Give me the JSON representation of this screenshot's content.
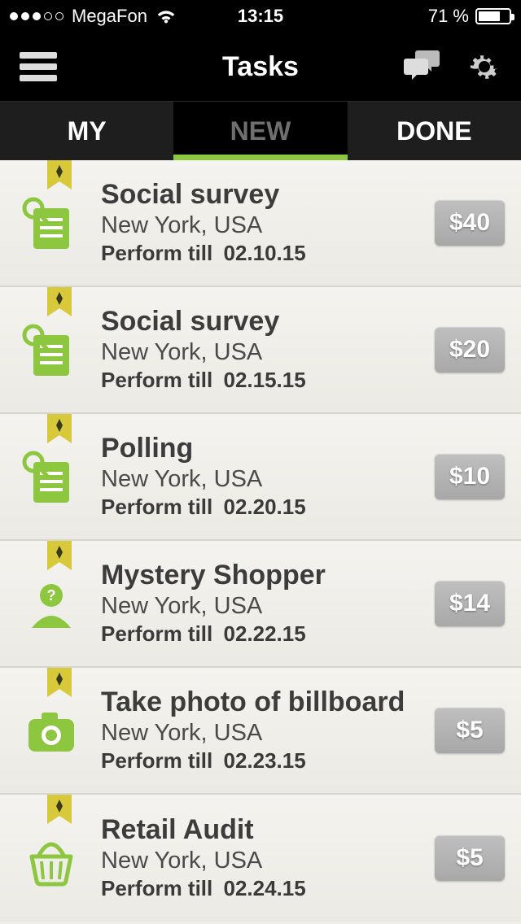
{
  "status": {
    "carrier": "MegaFon",
    "time": "13:15",
    "battery_pct": "71 %"
  },
  "nav": {
    "title": "Tasks"
  },
  "tabs": {
    "my": "MY",
    "new": "NEW",
    "done": "DONE",
    "active": "new"
  },
  "due_label": "Perform till",
  "tasks": [
    {
      "title": "Social survey",
      "location": "New York, USA",
      "due": "02.10.15",
      "price": "$40",
      "icon": "document"
    },
    {
      "title": "Social survey",
      "location": "New York, USA",
      "due": "02.15.15",
      "price": "$20",
      "icon": "document"
    },
    {
      "title": "Polling",
      "location": "New York, USA",
      "due": "02.20.15",
      "price": "$10",
      "icon": "document"
    },
    {
      "title": "Mystery Shopper",
      "location": "New York, USA",
      "due": "02.22.15",
      "price": "$14",
      "icon": "person"
    },
    {
      "title": "Take photo of billboard",
      "location": "New York, USA",
      "due": "02.23.15",
      "price": "$5",
      "icon": "camera"
    },
    {
      "title": "Retail Audit",
      "location": "New York, USA",
      "due": "02.24.15",
      "price": "$5",
      "icon": "basket"
    }
  ]
}
